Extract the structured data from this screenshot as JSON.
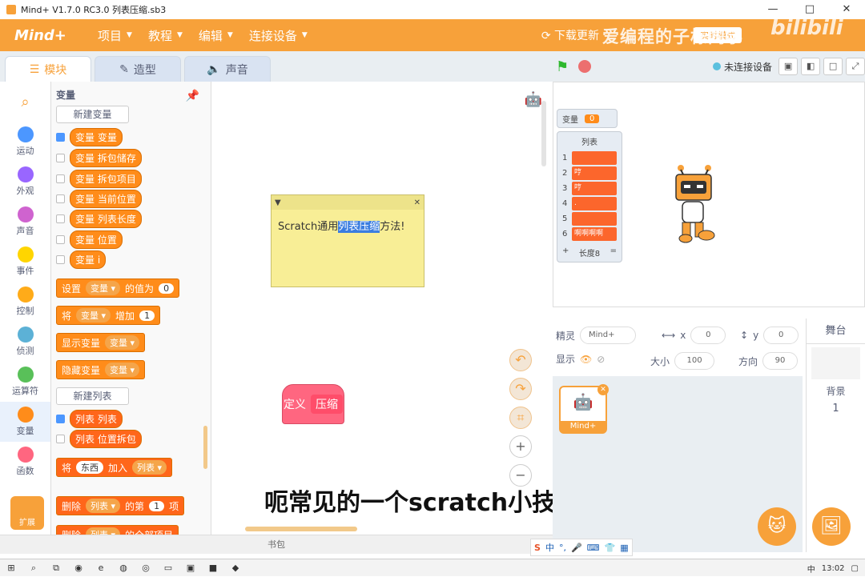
{
  "window": {
    "title": "Mind+ V1.7.0 RC3.0   列表压缩.sb3",
    "controls": [
      "—",
      "□",
      "✕"
    ]
  },
  "menubar": {
    "logo": "Mind+",
    "items": [
      {
        "label": "项目"
      },
      {
        "label": "教程"
      },
      {
        "label": "编辑"
      },
      {
        "label": "连接设备"
      }
    ],
    "update": "下载更新",
    "mode_btn": "实时模式",
    "watermark": "爱编程的子栋同学",
    "bili": "bilibili"
  },
  "tabs": [
    {
      "label": "模块",
      "icon": "blocks-icon"
    },
    {
      "label": "造型",
      "icon": "brush-icon"
    },
    {
      "label": "声音",
      "icon": "speaker-icon"
    }
  ],
  "stage_controls": {
    "connect": "未连接设备"
  },
  "categories": [
    {
      "label": "运动",
      "color": "#4c97ff"
    },
    {
      "label": "外观",
      "color": "#9966ff"
    },
    {
      "label": "声音",
      "color": "#cf63cf"
    },
    {
      "label": "事件",
      "color": "#ffd500"
    },
    {
      "label": "控制",
      "color": "#ffab19"
    },
    {
      "label": "侦测",
      "color": "#5cb1d6"
    },
    {
      "label": "运算符",
      "color": "#59c059"
    },
    {
      "label": "变量",
      "color": "#ff8c1a"
    },
    {
      "label": "函数",
      "color": "#ff6680"
    }
  ],
  "extension": "扩展",
  "palette": {
    "title": "变量",
    "new_var": "新建变量",
    "vars": [
      {
        "label": "变量 变量",
        "checked": true
      },
      {
        "label": "变量 拆包储存",
        "checked": false
      },
      {
        "label": "变量 拆包项目",
        "checked": false
      },
      {
        "label": "变量 当前位置",
        "checked": false
      },
      {
        "label": "变量 列表长度",
        "checked": false
      },
      {
        "label": "变量 位置",
        "checked": false
      },
      {
        "label": "变量 i",
        "checked": false
      }
    ],
    "set_block": {
      "a": "设置",
      "dd": "变量",
      "b": "的值为",
      "val": "0"
    },
    "change_block": {
      "a": "将",
      "dd": "变量",
      "b": "增加",
      "val": "1"
    },
    "show_block": {
      "a": "显示变量",
      "dd": "变量"
    },
    "hide_block": {
      "a": "隐藏变量",
      "dd": "变量"
    },
    "new_list": "新建列表",
    "lists": [
      {
        "label": "列表 列表",
        "checked": true
      },
      {
        "label": "列表 位置拆包",
        "checked": false
      }
    ],
    "add_block": {
      "a": "将",
      "val": "东西",
      "b": "加入",
      "dd": "列表"
    },
    "del_block": {
      "a": "删除",
      "dd": "列表",
      "b": "的第",
      "val": "1",
      "c": "项"
    },
    "delall_block": {
      "a": "删除",
      "dd": "列表",
      "b": "的全部项目"
    }
  },
  "workspace": {
    "note_pre": "Scratch通用",
    "note_hl": "列表压缩",
    "note_post": "方法!",
    "def_a": "定义",
    "def_b": "压缩"
  },
  "bookbar": "书包",
  "subtitle": "呃常见的一个scratch小技巧啊",
  "stage": {
    "var_label": "变量",
    "var_value": "0",
    "list_title": "列表",
    "list_items": [
      {
        "idx": "1",
        "val": ""
      },
      {
        "idx": "2",
        "val": "哼"
      },
      {
        "idx": "3",
        "val": "哼"
      },
      {
        "idx": "4",
        "val": "."
      },
      {
        "idx": "5",
        "val": ""
      },
      {
        "idx": "6",
        "val": "啊啊啊啊"
      }
    ],
    "list_add": "+",
    "list_length": "长度8",
    "list_eq": "="
  },
  "sprite_info": {
    "sprite_label": "精灵",
    "sprite_name": "Mind+",
    "x_label": "x",
    "x_val": "0",
    "y_label": "y",
    "y_val": "0",
    "show_label": "显示",
    "size_label": "大小",
    "size_val": "100",
    "dir_label": "方向",
    "dir_val": "90"
  },
  "sprite_card": {
    "name": "Mind+"
  },
  "stage_panel": {
    "title": "舞台",
    "bg_label": "背景",
    "bg_count": "1"
  },
  "taskbar": {
    "ime": "中",
    "time": "13:02"
  }
}
